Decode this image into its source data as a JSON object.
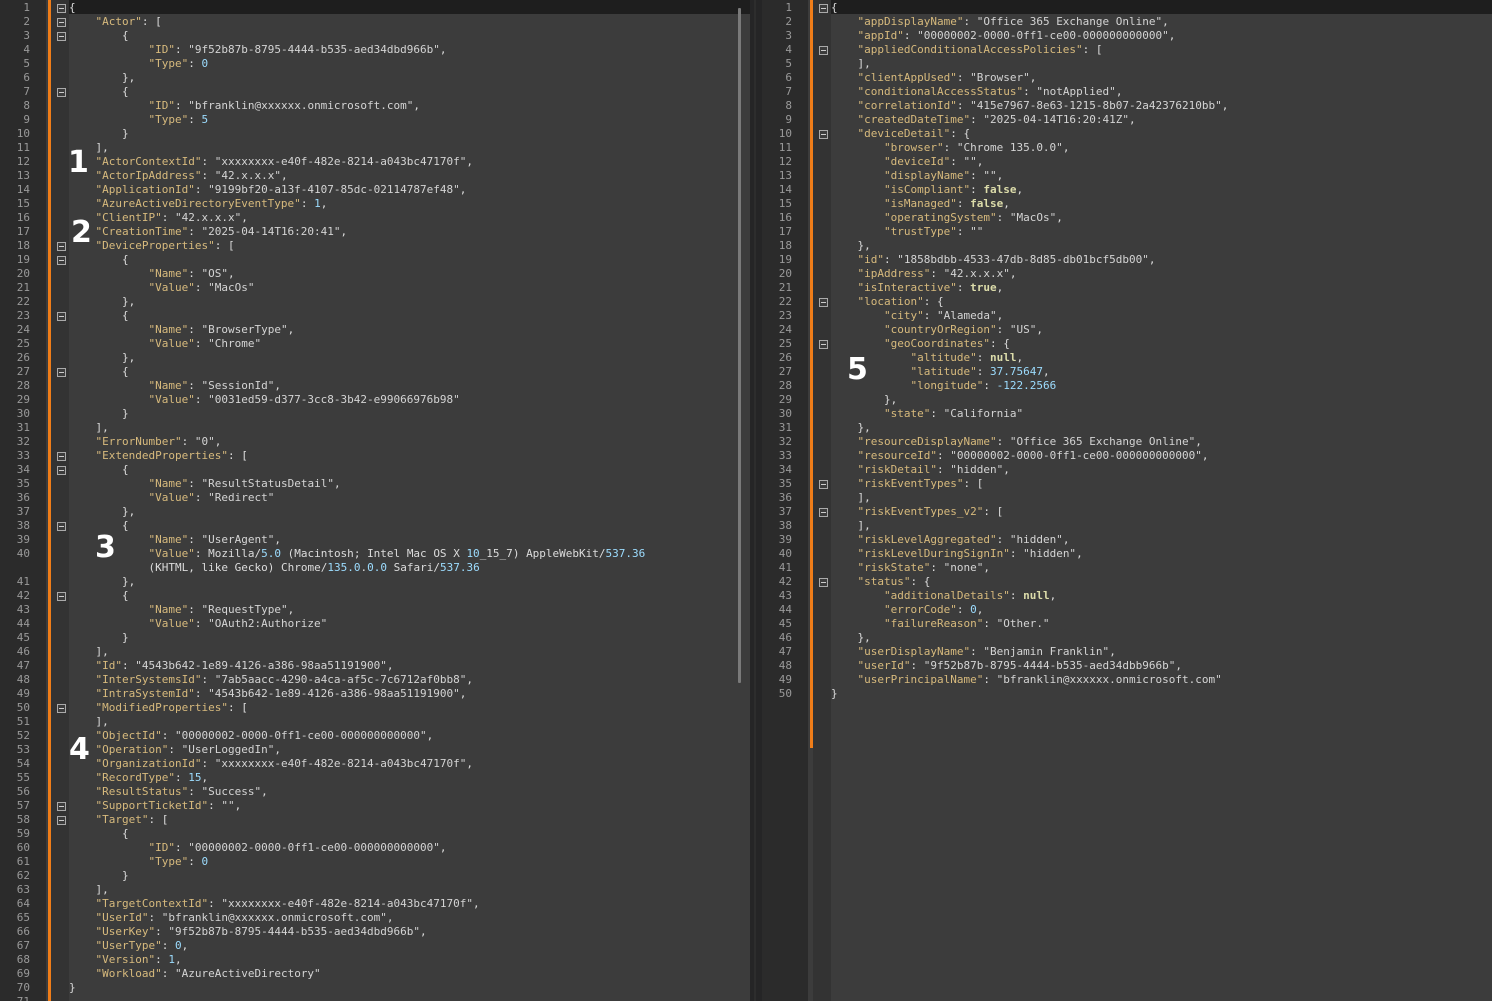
{
  "left": {
    "line_numbers": [
      "1",
      "2",
      "3",
      "4",
      "5",
      "6",
      "7",
      "8",
      "9",
      "10",
      "11",
      "12",
      "13",
      "14",
      "15",
      "16",
      "17",
      "18",
      "19",
      "20",
      "21",
      "22",
      "23",
      "24",
      "25",
      "26",
      "27",
      "28",
      "29",
      "30",
      "31",
      "32",
      "33",
      "34",
      "35",
      "36",
      "37",
      "38",
      "39",
      "40",
      "",
      "41",
      "42",
      "43",
      "44",
      "45",
      "46",
      "47",
      "48",
      "49",
      "50",
      "51",
      "52",
      "53",
      "54",
      "55",
      "56",
      "57",
      "58",
      "59",
      "60",
      "61",
      "62",
      "63",
      "64",
      "65",
      "66",
      "67",
      "68",
      "69",
      "70",
      "71"
    ],
    "lines": [
      "{",
      "    \"Actor\": [",
      "        {",
      "            \"ID\": \"9f52b87b-8795-4444-b535-aed34dbd966b\",",
      "            \"Type\": 0",
      "        },",
      "        {",
      "            \"ID\": \"bfranklin@xxxxxx.onmicrosoft.com\",",
      "            \"Type\": 5",
      "        }",
      "    ],",
      "    \"ActorContextId\": \"xxxxxxxx-e40f-482e-8214-a043bc47170f\",",
      "    \"ActorIpAddress\": \"42.x.x.x\",",
      "    \"ApplicationId\": \"9199bf20-a13f-4107-85dc-02114787ef48\",",
      "    \"AzureActiveDirectoryEventType\": 1,",
      "    \"ClientIP\": \"42.x.x.x\",",
      "    \"CreationTime\": \"2025-04-14T16:20:41\",",
      "    \"DeviceProperties\": [",
      "        {",
      "            \"Name\": \"OS\",",
      "            \"Value\": \"MacOs\"",
      "        },",
      "        {",
      "            \"Name\": \"BrowserType\",",
      "            \"Value\": \"Chrome\"",
      "        },",
      "        {",
      "            \"Name\": \"SessionId\",",
      "            \"Value\": \"0031ed59-d377-3cc8-3b42-e99066976b98\"",
      "        }",
      "    ],",
      "    \"ErrorNumber\": \"0\",",
      "    \"ExtendedProperties\": [",
      "        {",
      "            \"Name\": \"ResultStatusDetail\",",
      "            \"Value\": \"Redirect\"",
      "        },",
      "        {",
      "            \"Name\": \"UserAgent\",",
      "            \"Value\": \"Mozilla/5.0 (Macintosh; Intel Mac OS X 10_15_7) AppleWebKit/537.36",
      "            (KHTML, like Gecko) Chrome/135.0.0.0 Safari/537.36\"",
      "        },",
      "        {",
      "            \"Name\": \"RequestType\",",
      "            \"Value\": \"OAuth2:Authorize\"",
      "        }",
      "    ],",
      "    \"Id\": \"4543b642-1e89-4126-a386-98aa51191900\",",
      "    \"InterSystemsId\": \"7ab5aacc-4290-a4ca-af5c-7c6712af0bb8\",",
      "    \"IntraSystemId\": \"4543b642-1e89-4126-a386-98aa51191900\",",
      "    \"ModifiedProperties\": [",
      "    ],",
      "    \"ObjectId\": \"00000002-0000-0ff1-ce00-000000000000\",",
      "    \"Operation\": \"UserLoggedIn\",",
      "    \"OrganizationId\": \"xxxxxxxx-e40f-482e-8214-a043bc47170f\",",
      "    \"RecordType\": 15,",
      "    \"ResultStatus\": \"Success\",",
      "    \"SupportTicketId\": \"\",",
      "    \"Target\": [",
      "        {",
      "            \"ID\": \"00000002-0000-0ff1-ce00-000000000000\",",
      "            \"Type\": 0",
      "        }",
      "    ],",
      "    \"TargetContextId\": \"xxxxxxxx-e40f-482e-8214-a043bc47170f\",",
      "    \"UserId\": \"bfranklin@xxxxxx.onmicrosoft.com\",",
      "    \"UserKey\": \"9f52b87b-8795-4444-b535-aed34dbd966b\",",
      "    \"UserType\": 0,",
      "    \"Version\": 1,",
      "    \"Workload\": \"AzureActiveDirectory\"",
      "}",
      ""
    ],
    "annotations": [
      "1",
      "2",
      "3",
      "4"
    ]
  },
  "right": {
    "line_numbers": [
      "1",
      "2",
      "3",
      "4",
      "5",
      "6",
      "7",
      "8",
      "9",
      "10",
      "11",
      "12",
      "13",
      "14",
      "15",
      "16",
      "17",
      "18",
      "19",
      "20",
      "21",
      "22",
      "23",
      "24",
      "25",
      "26",
      "27",
      "28",
      "29",
      "30",
      "31",
      "32",
      "33",
      "34",
      "35",
      "36",
      "37",
      "38",
      "39",
      "40",
      "41",
      "42",
      "43",
      "44",
      "45",
      "46",
      "47",
      "48",
      "49",
      "50"
    ],
    "lines": [
      "{",
      "    \"appDisplayName\": \"Office 365 Exchange Online\",",
      "    \"appId\": \"00000002-0000-0ff1-ce00-000000000000\",",
      "    \"appliedConditionalAccessPolicies\": [",
      "    ],",
      "    \"clientAppUsed\": \"Browser\",",
      "    \"conditionalAccessStatus\": \"notApplied\",",
      "    \"correlationId\": \"415e7967-8e63-1215-8b07-2a42376210bb\",",
      "    \"createdDateTime\": \"2025-04-14T16:20:41Z\",",
      "    \"deviceDetail\": {",
      "        \"browser\": \"Chrome 135.0.0\",",
      "        \"deviceId\": \"\",",
      "        \"displayName\": \"\",",
      "        \"isCompliant\": false,",
      "        \"isManaged\": false,",
      "        \"operatingSystem\": \"MacOs\",",
      "        \"trustType\": \"\"",
      "    },",
      "    \"id\": \"1858bdbb-4533-47db-8d85-db01bcf5db00\",",
      "    \"ipAddress\": \"42.x.x.x\",",
      "    \"isInteractive\": true,",
      "    \"location\": {",
      "        \"city\": \"Alameda\",",
      "        \"countryOrRegion\": \"US\",",
      "        \"geoCoordinates\": {",
      "            \"altitude\": null,",
      "            \"latitude\": 37.75647,",
      "            \"longitude\": -122.2566",
      "        },",
      "        \"state\": \"California\"",
      "    },",
      "    \"resourceDisplayName\": \"Office 365 Exchange Online\",",
      "    \"resourceId\": \"00000002-0000-0ff1-ce00-000000000000\",",
      "    \"riskDetail\": \"hidden\",",
      "    \"riskEventTypes\": [",
      "    ],",
      "    \"riskEventTypes_v2\": [",
      "    ],",
      "    \"riskLevelAggregated\": \"hidden\",",
      "    \"riskLevelDuringSignIn\": \"hidden\",",
      "    \"riskState\": \"none\",",
      "    \"status\": {",
      "        \"additionalDetails\": null,",
      "        \"errorCode\": 0,",
      "        \"failureReason\": \"Other.\"",
      "    },",
      "    \"userDisplayName\": \"Benjamin Franklin\",",
      "    \"userId\": \"9f52b87b-8795-4444-b535-aed34dbb966b\",",
      "    \"userPrincipalName\": \"bfranklin@xxxxxx.onmicrosoft.com\"",
      "}"
    ],
    "annotations": [
      "5"
    ]
  },
  "colors": {
    "background": "#3c3c3c",
    "gutter": "#2b2b2b",
    "change_bar": "#ef7d19",
    "key": "#d7ba7d",
    "number": "#9cdcfe",
    "boolean": "#dcdcaa"
  }
}
